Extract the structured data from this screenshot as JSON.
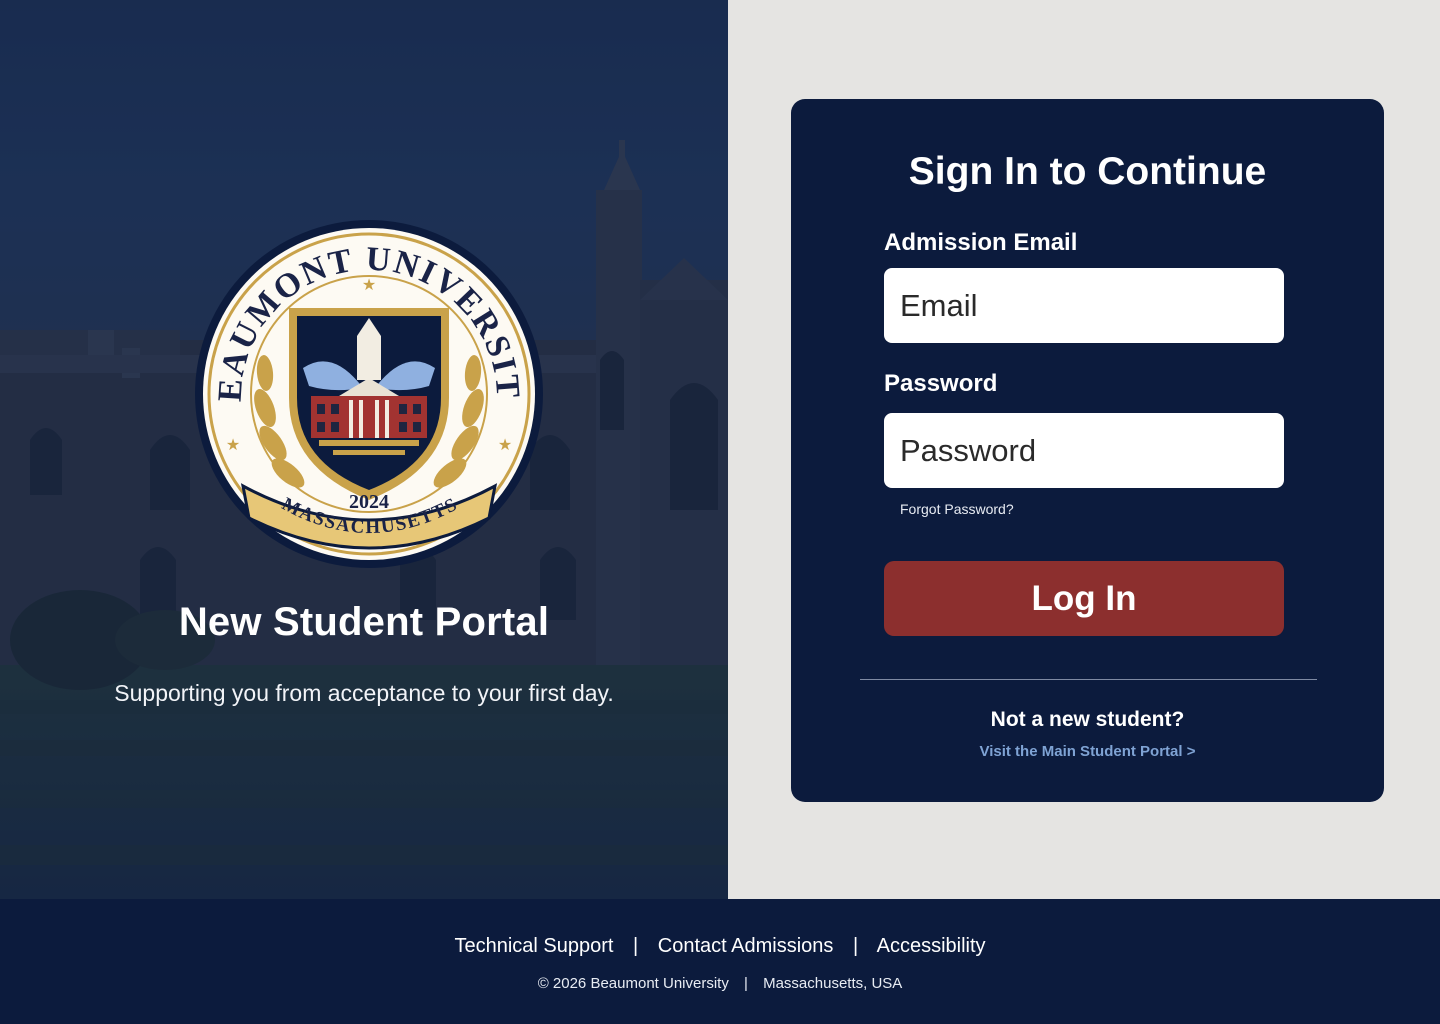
{
  "hero": {
    "crest": {
      "name": "BEAUMONT UNIVERSITY",
      "year": "2024",
      "state": "MASSACHUSETTS"
    },
    "title": "New Student Portal",
    "subtitle": "Supporting you from acceptance to your first day."
  },
  "login": {
    "heading": "Sign In to Continue",
    "email_label": "Admission Email",
    "email_placeholder": "Email",
    "password_label": "Password",
    "password_placeholder": "Password",
    "forgot_label": "Forgot Password?",
    "submit_label": "Log In",
    "not_new": "Not a new student?",
    "main_portal_link": "Visit the Main Student Portal >"
  },
  "footer": {
    "links": [
      "Technical Support",
      "Contact Admissions",
      "Accessibility"
    ],
    "separator": "|",
    "copyright": "©  2026 Beaumont University",
    "location": "Massachusetts, USA"
  },
  "colors": {
    "navy": "#0c1b3d",
    "button": "#8c2f2e",
    "link": "#7fa3d4",
    "page_bg": "#e5e4e2",
    "gold": "#c9a24a"
  }
}
